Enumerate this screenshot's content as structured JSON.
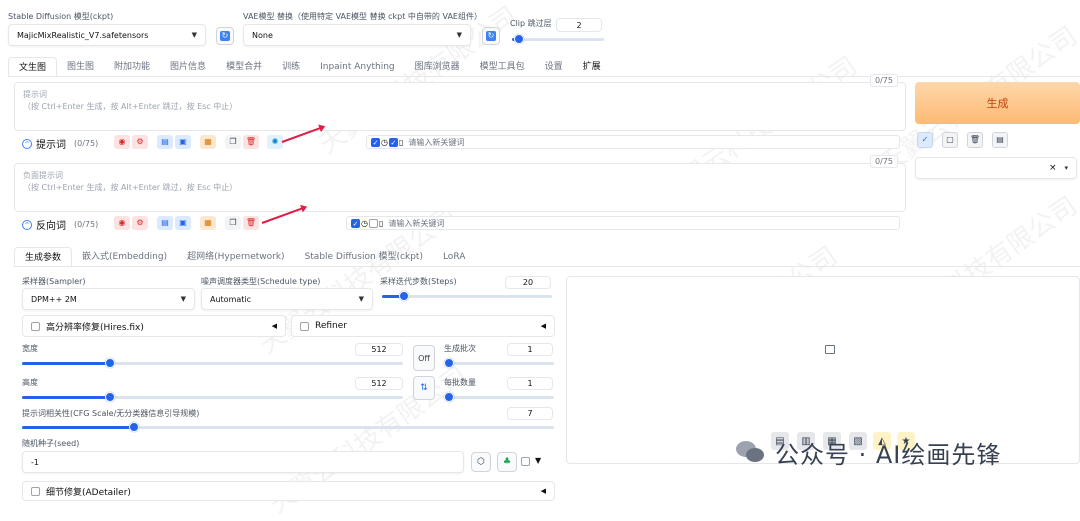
{
  "header": {
    "model_label": "Stable Diffusion 模型(ckpt)",
    "model_value": "MajicMixRealistic_V7.safetensors",
    "vae_label": "VAE模型 替换（使用特定 VAE模型 替换 ckpt 中自带的 VAE组件）",
    "vae_value": "None",
    "clip_label": "Clip 跳过层",
    "clip_value": "2",
    "clip_fraction": 0.08
  },
  "tabs": [
    "文生图",
    "图生图",
    "附加功能",
    "图片信息",
    "模型合并",
    "训练",
    "Inpaint Anything",
    "图库浏览器",
    "模型工具包",
    "设置",
    "扩展"
  ],
  "prompt": {
    "placeholder_title": "提示词",
    "placeholder_hint": "（按 Ctrl+Enter 生成，按 Alt+Enter 跳过，按 Esc 中止）",
    "token_count": "0/75",
    "label": "提示词",
    "count": "(0/75)",
    "keyword_placeholder": "请输入新关键词"
  },
  "neg_prompt": {
    "placeholder_title": "负面提示词",
    "placeholder_hint": "（按 Ctrl+Enter 生成，按 Alt+Enter 跳过，按 Esc 中止）",
    "token_count": "0/75",
    "label": "反向词",
    "count": "(0/75)",
    "keyword_placeholder": "请输入新关键词"
  },
  "generate_label": "生成",
  "style_close": "×",
  "subtabs": [
    "生成参数",
    "嵌入式(Embedding)",
    "超网络(Hypernetwork)",
    "Stable Diffusion 模型(ckpt)",
    "LoRA"
  ],
  "params": {
    "sampler_label": "采样器(Sampler)",
    "sampler_value": "DPM++ 2M",
    "schedule_label": "噪声调度器类型(Schedule type)",
    "schedule_value": "Automatic",
    "steps_label": "采样迭代步数(Steps)",
    "steps_value": "20",
    "steps_fraction": 0.13,
    "hires_label": "高分辨率修复(Hires.fix)",
    "refiner_label": "Refiner",
    "width_label": "宽度",
    "width_value": "512",
    "width_fraction": 0.23,
    "height_label": "高度",
    "height_value": "512",
    "height_fraction": 0.23,
    "off_label": "Off",
    "swap_label": "⇅",
    "batch_count_label": "生成批次",
    "batch_count_value": "1",
    "batch_count_fraction": 0.0,
    "batch_size_label": "每批数量",
    "batch_size_value": "1",
    "batch_size_fraction": 0.0,
    "cfg_label": "提示词相关性(CFG Scale/无分类器信息引导规模)",
    "cfg_value": "7",
    "cfg_fraction": 0.21,
    "seed_label": "随机种子(seed)",
    "seed_value": "-1",
    "adetailer_label": "细节修复(ADetailer)"
  },
  "watermark": {
    "brand": "公众号 · AI绘画先锋",
    "diagonal_text": "天翼云科技有限公司",
    "diagonal_sub": "工限"
  },
  "colors": {
    "accent": "#2563eb",
    "generate_bg": "#fdba74",
    "arrow": "#e11d48"
  }
}
